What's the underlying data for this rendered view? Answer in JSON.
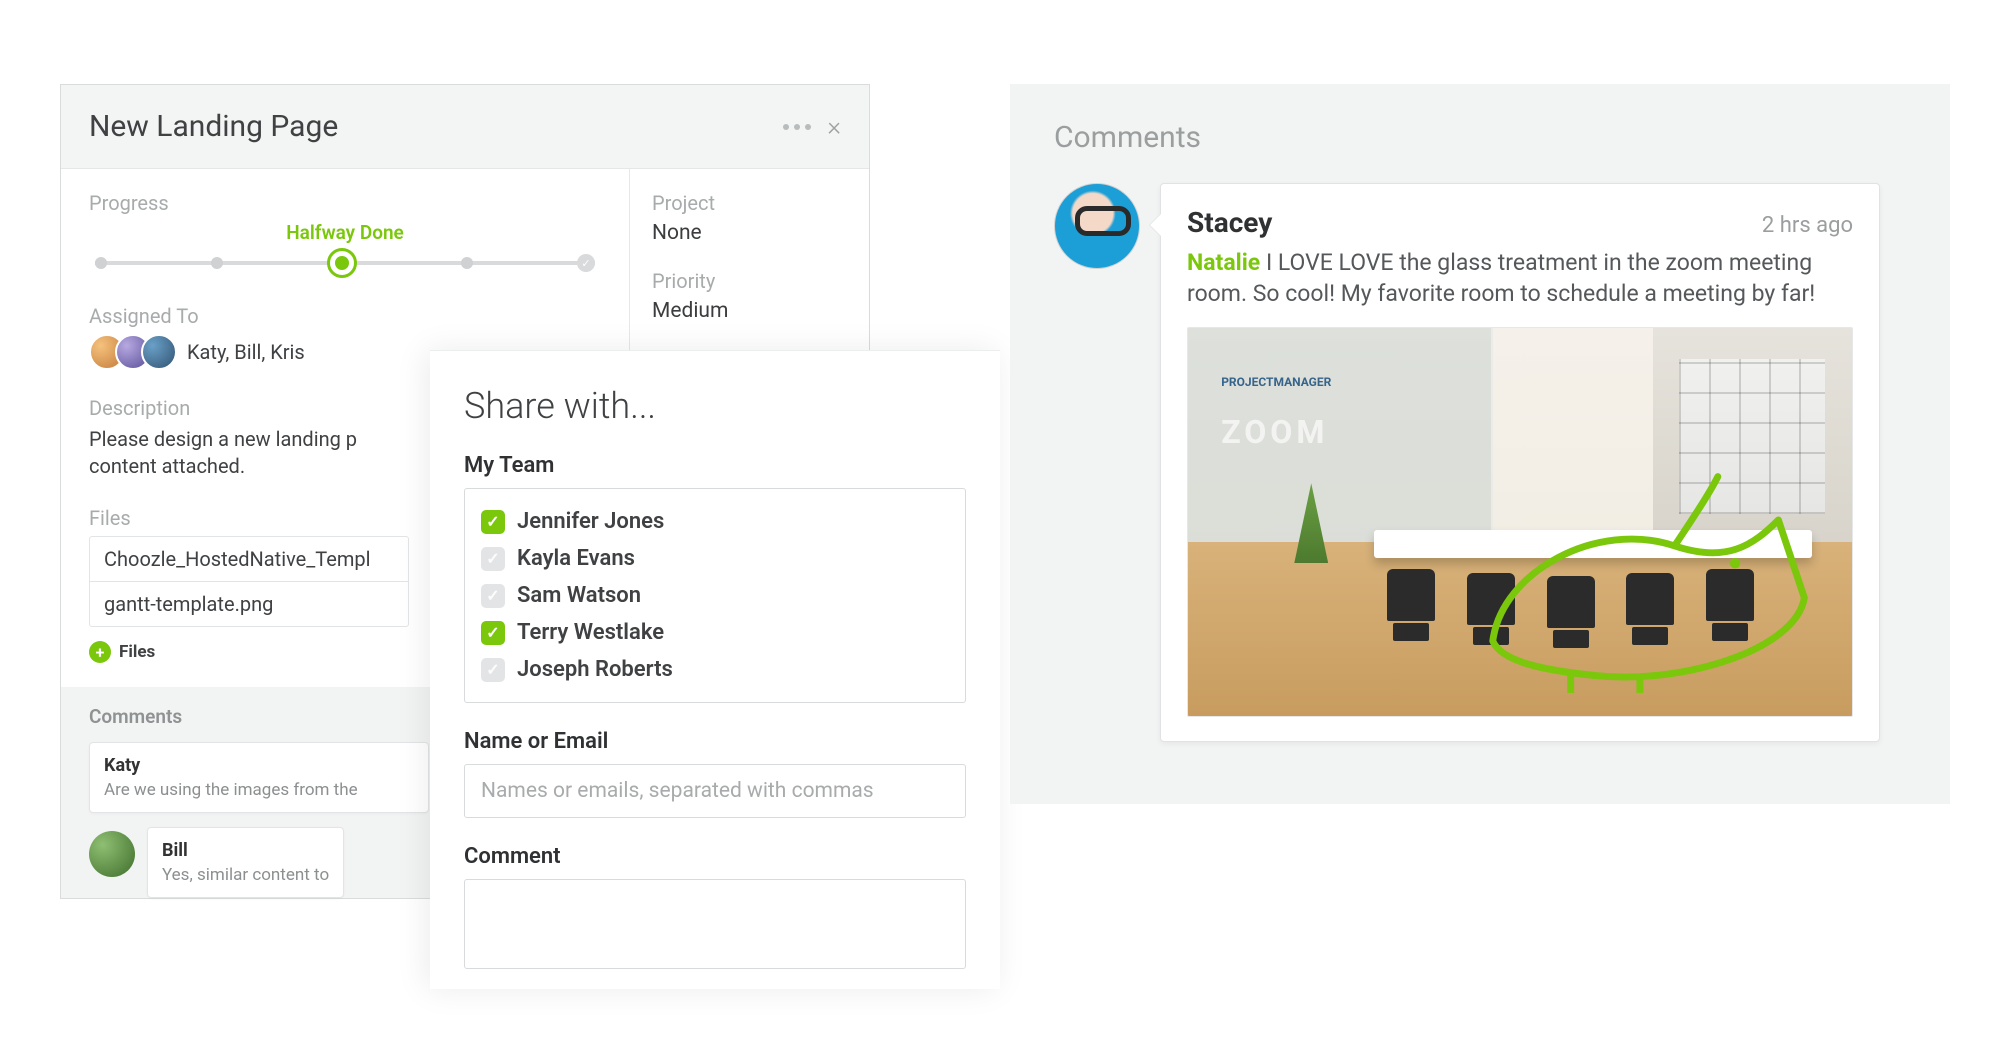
{
  "task": {
    "title": "New Landing Page",
    "progress": {
      "label": "Progress",
      "status_label": "Halfway Done",
      "current_step": 2,
      "total_steps": 5
    },
    "project": {
      "label": "Project",
      "value": "None"
    },
    "priority": {
      "label": "Priority",
      "value": "Medium"
    },
    "assigned": {
      "label": "Assigned To",
      "names": "Katy, Bill, Kris"
    },
    "description": {
      "label": "Description",
      "text": "Please design a new landing p\ncontent attached."
    },
    "files": {
      "label": "Files",
      "items": [
        "Choozle_HostedNative_Templ",
        "gantt-template.png"
      ],
      "add_label": "Files"
    },
    "comments": {
      "label": "Comments",
      "items": [
        {
          "author": "Katy",
          "text": "Are we using the images from the"
        },
        {
          "author": "Bill",
          "text": "Yes, similar content to"
        }
      ]
    }
  },
  "share": {
    "title": "Share with...",
    "team_label": "My Team",
    "team": [
      {
        "name": "Jennifer Jones",
        "checked": true
      },
      {
        "name": "Kayla Evans",
        "checked": false
      },
      {
        "name": "Sam Watson",
        "checked": false
      },
      {
        "name": "Terry Westlake",
        "checked": true
      },
      {
        "name": "Joseph Roberts",
        "checked": false
      }
    ],
    "name_email_label": "Name or Email",
    "name_email_placeholder": "Names or emails, separated with commas",
    "comment_label": "Comment"
  },
  "right_comments": {
    "title": "Comments",
    "entry": {
      "author": "Stacey",
      "time": "2 hrs ago",
      "mention": "Natalie",
      "body": " I LOVE LOVE the glass treatment in the zoom meeting room. So cool! My favorite room to schedule a meeting by far!",
      "attachment_zoom_label": "ZOOM",
      "attachment_pm_label_a": "PROJECT",
      "attachment_pm_label_b": "MANAGER"
    }
  }
}
